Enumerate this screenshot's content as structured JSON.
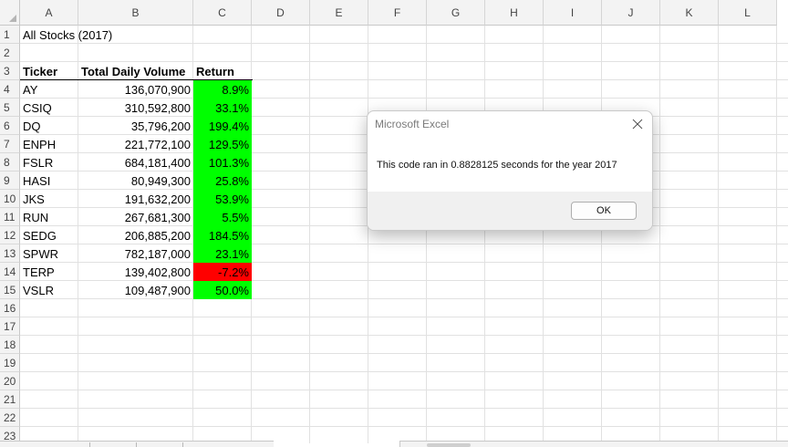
{
  "columns": [
    "A",
    "B",
    "C",
    "D",
    "E",
    "F",
    "G",
    "H",
    "I",
    "J",
    "K",
    "L"
  ],
  "rows": [
    "1",
    "2",
    "3",
    "4",
    "5",
    "6",
    "7",
    "8",
    "9",
    "10",
    "11",
    "12",
    "13",
    "14",
    "15",
    "16",
    "17",
    "18",
    "19",
    "20",
    "21",
    "22",
    "23"
  ],
  "sheet": {
    "title": "All Stocks (2017)",
    "headers": {
      "ticker": "Ticker",
      "volume": "Total Daily Volume",
      "return": "Return"
    },
    "data": [
      {
        "ticker": "AY",
        "volume": "136,070,900",
        "return": "8.9%",
        "positive": true
      },
      {
        "ticker": "CSIQ",
        "volume": "310,592,800",
        "return": "33.1%",
        "positive": true
      },
      {
        "ticker": "DQ",
        "volume": "35,796,200",
        "return": "199.4%",
        "positive": true
      },
      {
        "ticker": "ENPH",
        "volume": "221,772,100",
        "return": "129.5%",
        "positive": true
      },
      {
        "ticker": "FSLR",
        "volume": "684,181,400",
        "return": "101.3%",
        "positive": true
      },
      {
        "ticker": "HASI",
        "volume": "80,949,300",
        "return": "25.8%",
        "positive": true
      },
      {
        "ticker": "JKS",
        "volume": "191,632,200",
        "return": "53.9%",
        "positive": true
      },
      {
        "ticker": "RUN",
        "volume": "267,681,300",
        "return": "5.5%",
        "positive": true
      },
      {
        "ticker": "SEDG",
        "volume": "206,885,200",
        "return": "184.5%",
        "positive": true
      },
      {
        "ticker": "SPWR",
        "volume": "782,187,000",
        "return": "23.1%",
        "positive": true
      },
      {
        "ticker": "TERP",
        "volume": "139,402,800",
        "return": "-7.2%",
        "positive": false
      },
      {
        "ticker": "VSLR",
        "volume": "109,487,900",
        "return": "50.0%",
        "positive": true
      }
    ]
  },
  "colors": {
    "positive": "#00ff00",
    "negative": "#ff0000"
  },
  "dialog": {
    "title": "Microsoft Excel",
    "message": "This code ran in 0.8828125 seconds for the year 2017",
    "ok_label": "OK",
    "close_icon": "close-icon"
  }
}
